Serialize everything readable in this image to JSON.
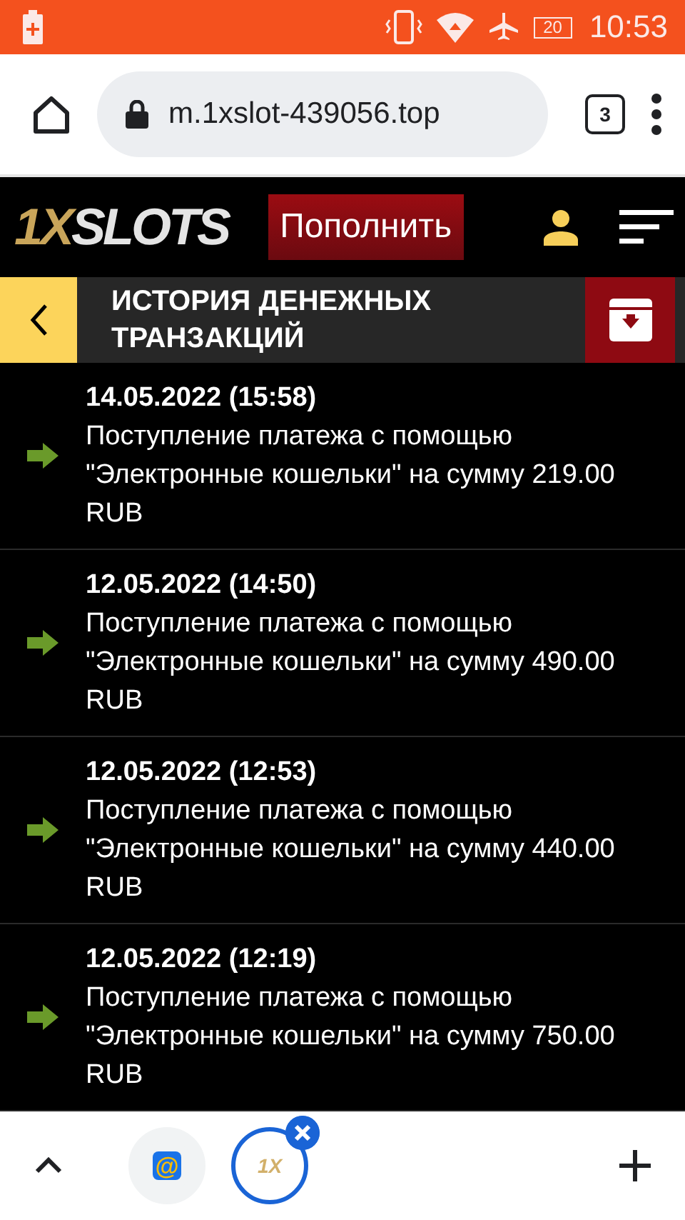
{
  "status_bar": {
    "battery_level": "20",
    "time": "10:53"
  },
  "browser": {
    "url": "m.1xslot-439056.top",
    "tab_count": "3"
  },
  "site_header": {
    "logo_prefix": "1X",
    "logo_rest": "SLOTS",
    "deposit_button": "Пополнить"
  },
  "page_title": "ИСТОРИЯ ДЕНЕЖНЫХ ТРАНЗАКЦИЙ",
  "transactions": [
    {
      "date": "14.05.2022 (15:58)",
      "description": "Поступление платежа с помощью \"Электронные кошельки\" на сумму 219.00 RUB"
    },
    {
      "date": "12.05.2022 (14:50)",
      "description": "Поступление платежа с помощью \"Электронные кошельки\" на сумму 490.00 RUB"
    },
    {
      "date": "12.05.2022 (12:53)",
      "description": "Поступление платежа с помощью \"Электронные кошельки\" на сумму 440.00 RUB"
    },
    {
      "date": "12.05.2022 (12:19)",
      "description": "Поступление платежа с помощью \"Электронные кошельки\" на сумму 750.00 RUB"
    }
  ],
  "tab_strip": [
    {
      "kind": "mail",
      "icon_text": "@",
      "selected": false
    },
    {
      "kind": "site",
      "icon_text": "1X",
      "selected": true
    }
  ]
}
